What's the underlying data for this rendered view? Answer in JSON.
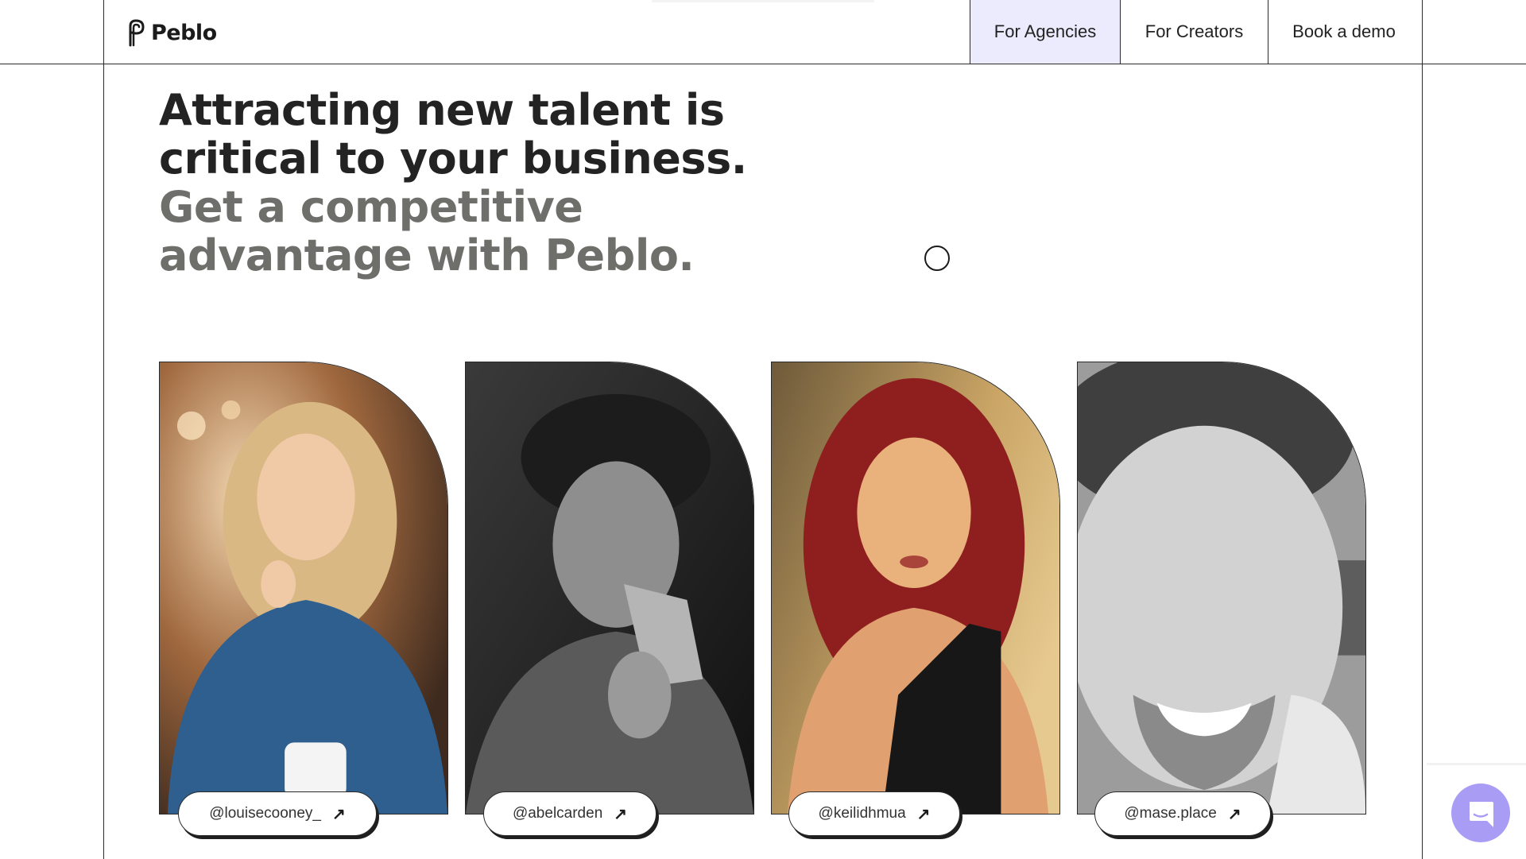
{
  "brand": {
    "name": "Peblo"
  },
  "nav": {
    "items": [
      {
        "label": "For Agencies",
        "active": true
      },
      {
        "label": "For Creators"
      },
      {
        "label": "Book a demo"
      }
    ],
    "active_color": "#eceafd"
  },
  "hero": {
    "headline_dark": "Attracting new talent is critical to your business.",
    "headline_muted": "Get a competitive advantage with Peblo."
  },
  "creators": [
    {
      "handle": "@louisecooney_",
      "arrow_icon": "arrow-up-right-icon"
    },
    {
      "handle": "@abelcarden",
      "arrow_icon": "arrow-up-right-icon"
    },
    {
      "handle": "@keilidhmua",
      "arrow_icon": "arrow-up-right-icon"
    },
    {
      "handle": "@mase.place",
      "arrow_icon": "arrow-up-right-icon"
    }
  ],
  "chat": {
    "icon": "chat-bubble-icon",
    "color": "#a99cf5"
  }
}
